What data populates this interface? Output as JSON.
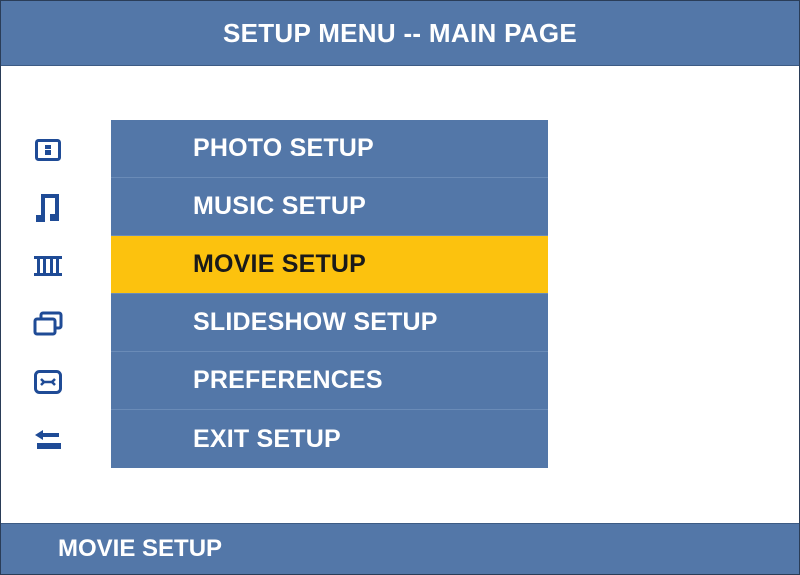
{
  "header": {
    "title": "SETUP MENU -- MAIN PAGE"
  },
  "menu": {
    "selected_index": 2,
    "items": [
      {
        "label": "PHOTO SETUP",
        "icon": "photo-icon"
      },
      {
        "label": "MUSIC SETUP",
        "icon": "music-note-icon"
      },
      {
        "label": "MOVIE SETUP",
        "icon": "film-strip-icon"
      },
      {
        "label": "SLIDESHOW SETUP",
        "icon": "slideshow-icon"
      },
      {
        "label": "PREFERENCES",
        "icon": "wrench-icon"
      },
      {
        "label": "EXIT SETUP",
        "icon": "exit-arrow-icon"
      }
    ]
  },
  "footer": {
    "status": "MOVIE SETUP"
  },
  "colors": {
    "bar_blue": "#5377a8",
    "highlight": "#fcc20e",
    "icon_blue": "#1f4b96"
  }
}
